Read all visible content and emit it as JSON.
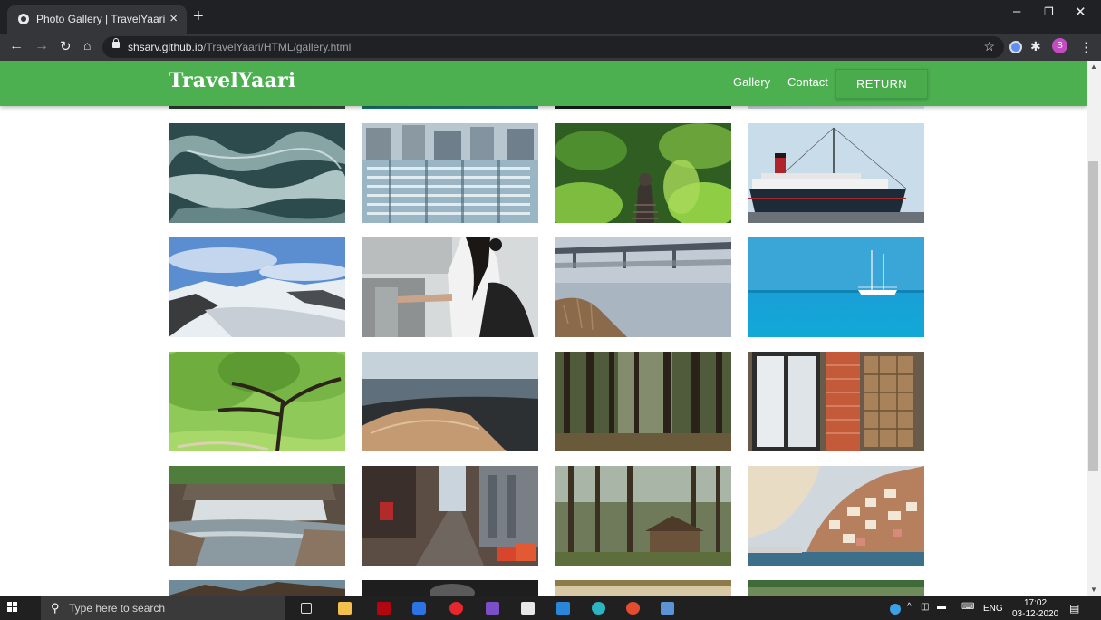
{
  "browser": {
    "tab_title": "Photo Gallery | TravelYaari",
    "url_domain": "shsarv.github.io",
    "url_path": "/TravelYaari/HTML/gallery.html",
    "profile_initial": "S"
  },
  "site": {
    "brand": "TravelYaari",
    "nav": {
      "gallery": "Gallery",
      "contact": "Contact",
      "return": "RETURN"
    },
    "header_color": "#4caf50"
  },
  "gallery": {
    "photos": [
      "ocean waves",
      "city apartment blocks",
      "buddha statue in plants",
      "ocean liner ship",
      "snowy glacier",
      "woman at turnstile",
      "bridge over river",
      "sailboat on blue sea",
      "green oak tree",
      "aerial coastline",
      "pine forest",
      "brick wall with window",
      "waterfall",
      "city street",
      "forest cabin",
      "coastal village"
    ]
  },
  "taskbar": {
    "search_placeholder": "Type here to search",
    "language": "ENG",
    "time": "17:02",
    "date": "03-12-2020"
  }
}
